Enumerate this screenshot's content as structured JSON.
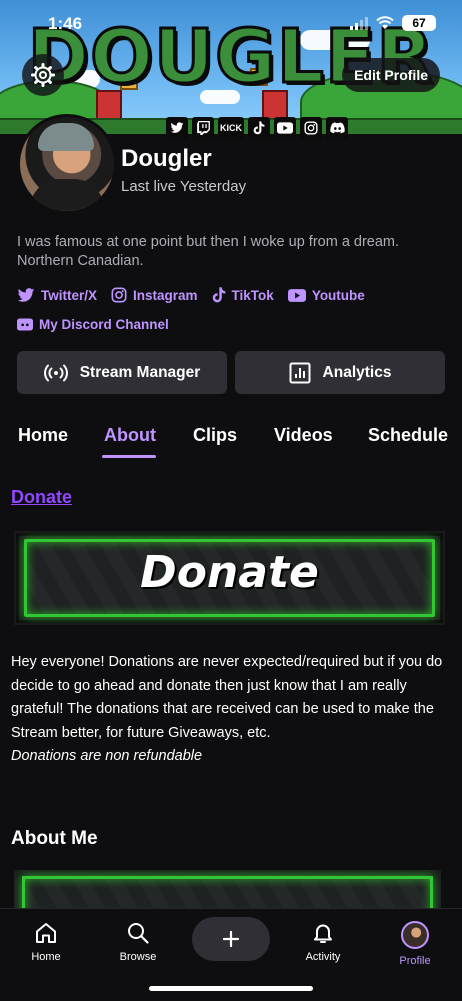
{
  "status_bar": {
    "time": "1:46",
    "battery": "67"
  },
  "banner": {
    "title": "DOUGLER",
    "edit_profile_label": "Edit Profile",
    "social_icons": [
      "twitter-icon",
      "twitch-icon",
      "kick-icon",
      "tiktok-icon",
      "youtube-icon",
      "instagram-icon",
      "discord-icon"
    ],
    "kick_label": "KICK"
  },
  "profile": {
    "username": "Dougler",
    "last_live": "Last live Yesterday",
    "bio": "I was famous at one point but then I woke up from a dream. Northern Canadian.",
    "links": [
      {
        "icon": "twitter-icon",
        "label": "Twitter/X"
      },
      {
        "icon": "instagram-icon",
        "label": "Instagram"
      },
      {
        "icon": "tiktok-icon",
        "label": "TikTok"
      },
      {
        "icon": "youtube-icon",
        "label": "Youtube"
      },
      {
        "icon": "discord-icon",
        "label": "My Discord Channel"
      }
    ]
  },
  "actions": {
    "stream_manager": "Stream Manager",
    "analytics": "Analytics"
  },
  "tabs": [
    {
      "label": "Home",
      "active": false
    },
    {
      "label": "About",
      "active": true
    },
    {
      "label": "Clips",
      "active": false
    },
    {
      "label": "Videos",
      "active": false
    },
    {
      "label": "Schedule",
      "active": false
    }
  ],
  "about": {
    "donate_link": "Donate",
    "donate_image_text": "Donate",
    "donate_description": "Hey everyone! Donations are never expected/required but if you do decide to go ahead and donate then just know that I am really grateful! The donations that are received can be used to make the Stream better, for future Giveaways, etc.",
    "donate_note": "Donations are non refundable",
    "about_me_title": "About Me"
  },
  "bottom_nav": [
    {
      "icon": "home-icon",
      "label": "Home",
      "active": false
    },
    {
      "icon": "search-icon",
      "label": "Browse",
      "active": false
    },
    {
      "icon": "plus-icon",
      "label": "",
      "active": false
    },
    {
      "icon": "bell-icon",
      "label": "Activity",
      "active": false
    },
    {
      "icon": "avatar",
      "label": "Profile",
      "active": true
    }
  ],
  "colors": {
    "accent": "#bf94ff",
    "link_purple": "#9147ff",
    "background": "#0e0e10",
    "button_bg": "#2f2f35",
    "panel_green": "#33c633"
  }
}
